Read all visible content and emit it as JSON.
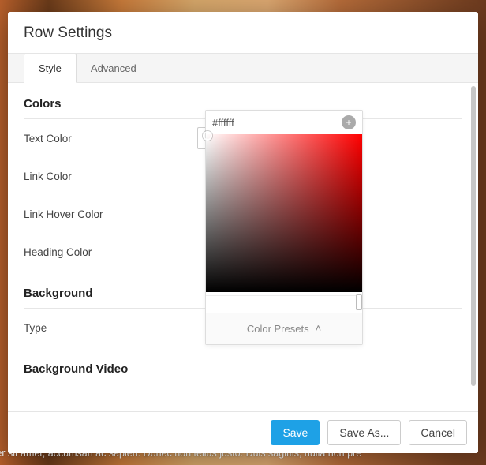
{
  "header": {
    "title": "Row Settings"
  },
  "tabs": {
    "style": "Style",
    "advanced": "Advanced",
    "active": "style"
  },
  "sections": {
    "colors": {
      "title": "Colors",
      "fields": {
        "text": "Text Color",
        "link": "Link Color",
        "link_hover": "Link Hover Color",
        "heading": "Heading Color"
      }
    },
    "background": {
      "title": "Background",
      "fields": {
        "type": "Type"
      }
    },
    "background_video": {
      "title": "Background Video"
    }
  },
  "color_picker": {
    "value": "#ffffff",
    "presets_label": "Color Presets",
    "add_icon": "+",
    "clear_icon": "×",
    "chevron_up": "˄"
  },
  "footer": {
    "save": "Save",
    "save_as": "Save As...",
    "cancel": "Cancel"
  },
  "lorem": "orcorper sit amet, accumsan ac sapien. Donec non tellus justo. Duis sagittis, nulla non pre"
}
